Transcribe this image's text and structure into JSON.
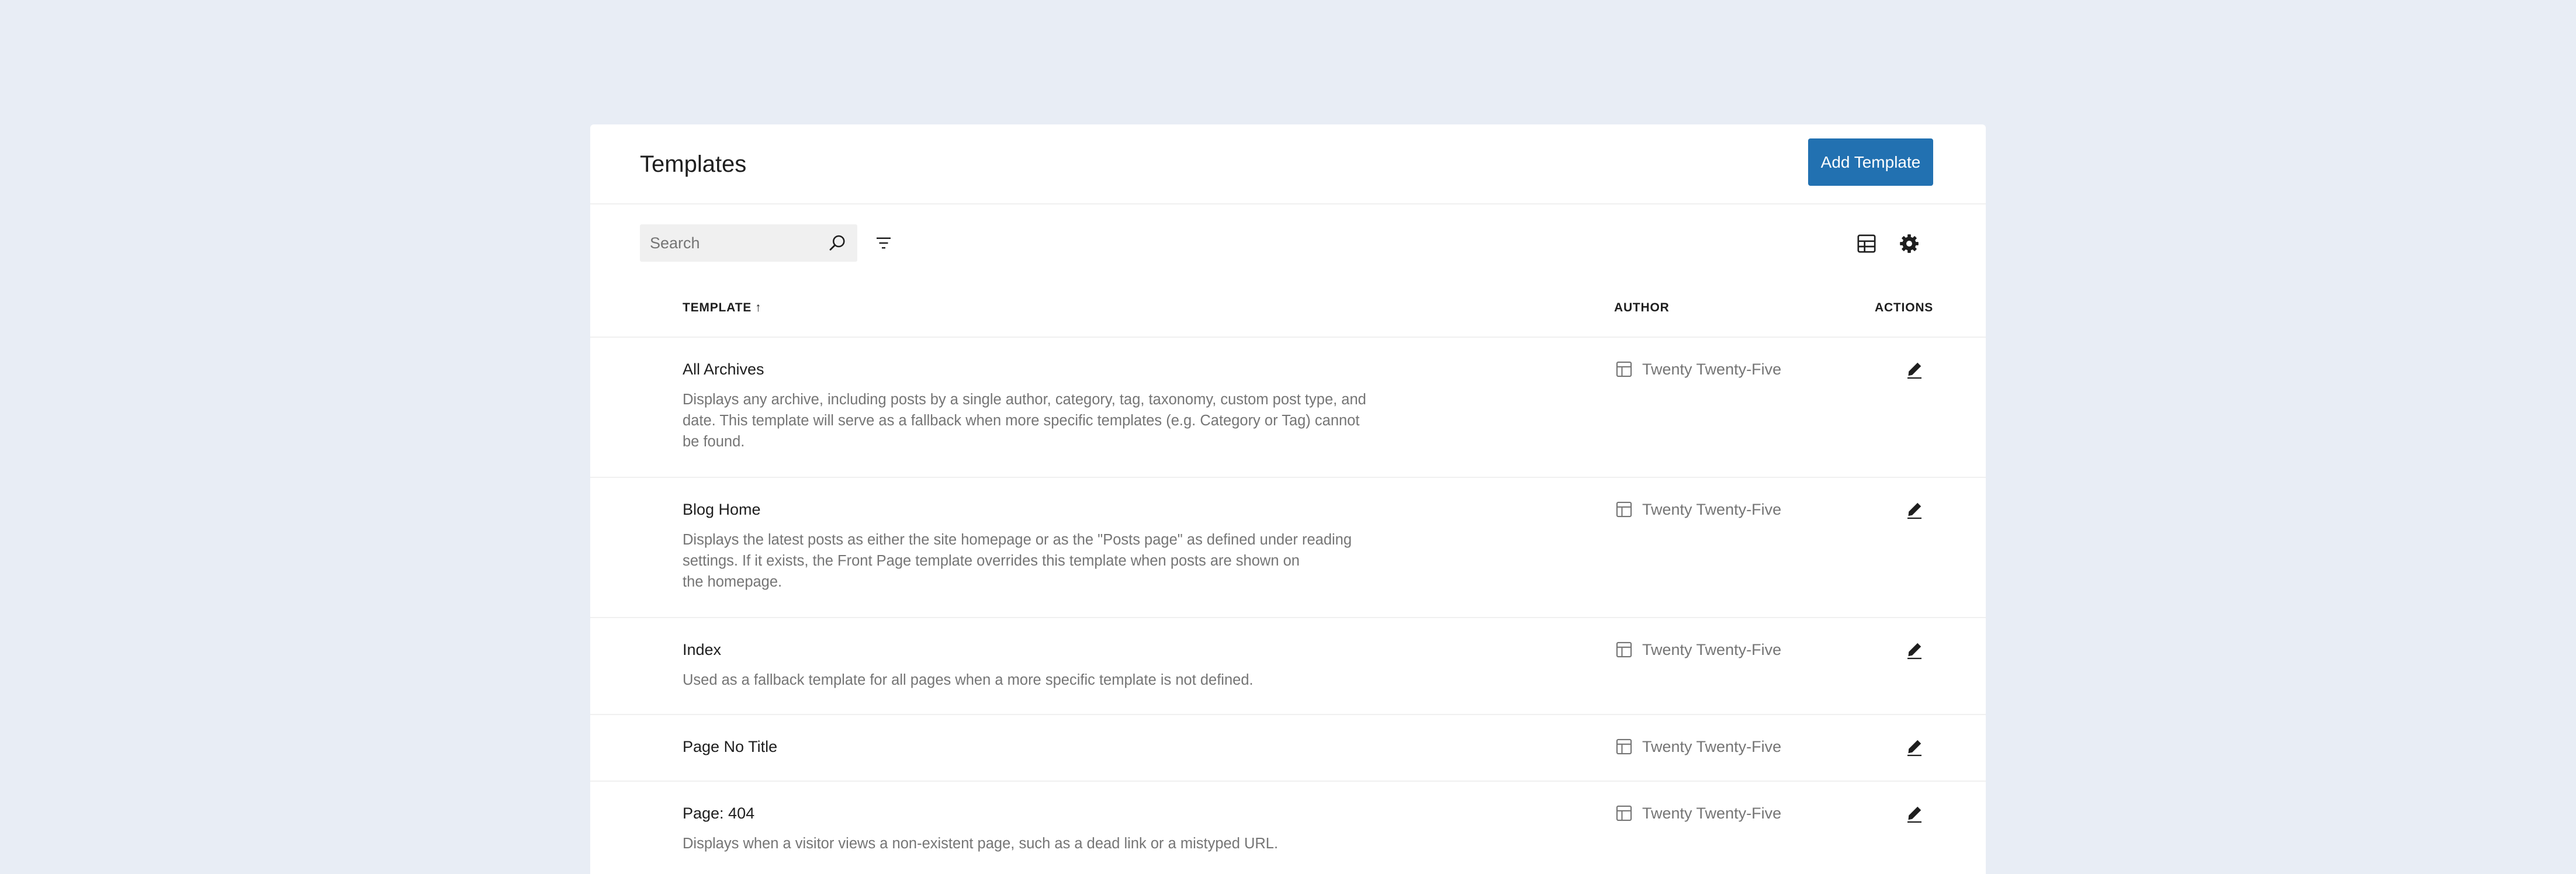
{
  "header": {
    "title": "Templates",
    "add_button_label": "Add Template"
  },
  "toolbar": {
    "search_placeholder": "Search",
    "search_value": "",
    "icons": {
      "search": "search-icon",
      "filter": "filter-icon",
      "layout": "table-layout-icon",
      "settings": "gear-icon"
    }
  },
  "table": {
    "columns": {
      "template": "TEMPLATE",
      "template_sort": "↑",
      "author": "AUTHOR",
      "actions": "ACTIONS"
    },
    "rows": [
      {
        "title": "All Archives",
        "lines": [
          "Displays any archive, including posts by a single author, category, tag, taxonomy, custom post type, and",
          "date. This template will serve as a fallback when more specific templates (e.g. Category or Tag) cannot",
          "be found."
        ],
        "author": "Twenty Twenty-Five"
      },
      {
        "title": "Blog Home",
        "lines": [
          "Displays the latest posts as either the site homepage or as the \"Posts page\" as defined under reading",
          "settings. If it exists, the Front Page template overrides this template when posts are shown on",
          "the homepage."
        ],
        "author": "Twenty Twenty-Five"
      },
      {
        "title": "Index",
        "lines": [
          "Used as a fallback template for all pages when a more specific template is not defined."
        ],
        "author": "Twenty Twenty-Five"
      },
      {
        "title": "Page No Title",
        "lines": [],
        "author": "Twenty Twenty-Five"
      },
      {
        "title": "Page: 404",
        "lines": [
          "Displays when a visitor views a non-existent page, such as a dead link or a mistyped URL."
        ],
        "author": "Twenty Twenty-Five"
      }
    ]
  },
  "colors": {
    "background": "#e8edf5",
    "accent": "#2271b1",
    "muted_text": "#757575"
  }
}
